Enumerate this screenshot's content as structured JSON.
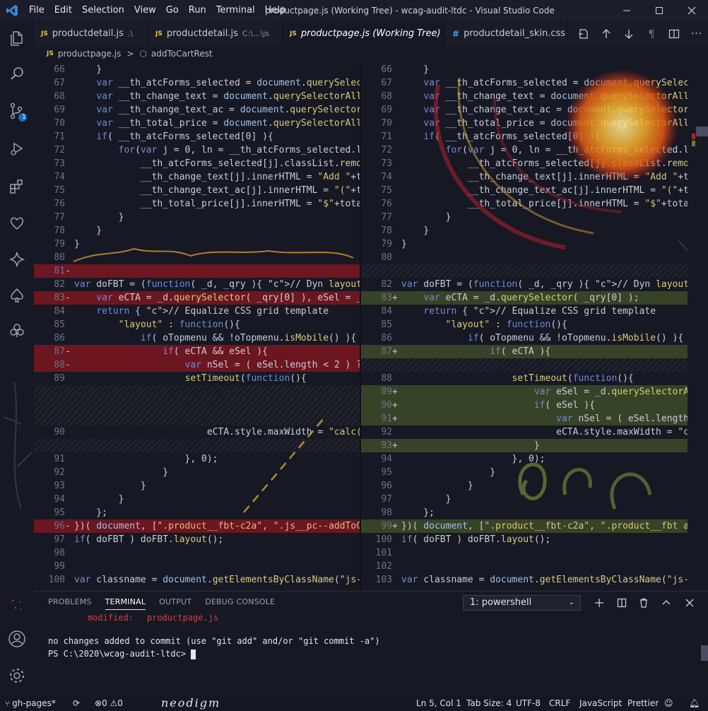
{
  "window": {
    "title": "productpage.js (Working Tree) - wcag-audit-ltdc - Visual Studio Code"
  },
  "menu": [
    "File",
    "Edit",
    "Selection",
    "View",
    "Go",
    "Run",
    "Terminal",
    "Help"
  ],
  "tabs": [
    {
      "icon": "JS",
      "label": "productdetail.js",
      "desc": ".\\"
    },
    {
      "icon": "JS",
      "label": "productdetail.js",
      "desc": "C:\\...\\js"
    },
    {
      "icon": "JS",
      "label": "productpage.js (Working Tree)",
      "desc": "",
      "active": true
    },
    {
      "icon": "#",
      "label": "productdetail_skin.css",
      "desc": ""
    }
  ],
  "breadcrumb": {
    "file": "productpage.js",
    "separator": ">",
    "symbol": "addToCartRest"
  },
  "scm_badge": "1",
  "colors": {
    "deleted": "#b4161e",
    "added": "#5f782d",
    "accent": "#0e70c0",
    "js_icon": "#e8c94a",
    "css_icon": "#4a9de0"
  },
  "left_lines": [
    {
      "n": "66",
      "m": "",
      "t": "    }",
      "cls": ""
    },
    {
      "n": "67",
      "m": "",
      "t": "    var __th_atcForms_selected = document.querySelectorAll(",
      "cls": ""
    },
    {
      "n": "68",
      "m": "",
      "t": "    var __th_change_text = document.querySelectorAll(",
      "cls": ""
    },
    {
      "n": "69",
      "m": "",
      "t": "    var __th_change_text_ac = document.querySelectorAll(",
      "cls": ""
    },
    {
      "n": "70",
      "m": "",
      "t": "    var __th_total_price = document.querySelectorAll(",
      "cls": ""
    },
    {
      "n": "71",
      "m": "",
      "t": "    if( __th_atcForms_selected[0] ){",
      "cls": ""
    },
    {
      "n": "72",
      "m": "",
      "t": "        for(var j = 0, ln = __th_atcForms_selected.length",
      "cls": ""
    },
    {
      "n": "73",
      "m": "",
      "t": "            __th_atcForms_selected[j].classList.remove(",
      "cls": ""
    },
    {
      "n": "74",
      "m": "",
      "t": "            __th_change_text[j].innerHTML = \"Add \"+total",
      "cls": ""
    },
    {
      "n": "75",
      "m": "",
      "t": "            __th_change_text_ac[j].innerHTML = \"(\"+tot",
      "cls": ""
    },
    {
      "n": "76",
      "m": "",
      "t": "            __th_total_price[j].innerHTML = \"$\"+total",
      "cls": ""
    },
    {
      "n": "77",
      "m": "",
      "t": "        }",
      "cls": ""
    },
    {
      "n": "78",
      "m": "",
      "t": "    }",
      "cls": ""
    },
    {
      "n": "79",
      "m": "",
      "t": "}",
      "cls": ""
    },
    {
      "n": "80",
      "m": "",
      "t": "",
      "cls": ""
    },
    {
      "n": "81",
      "m": "-",
      "t": "",
      "cls": "del"
    },
    {
      "n": "82",
      "m": "",
      "t": "var doFBT = (function( _d, _qry ){ // Dyn layout",
      "cls": ""
    },
    {
      "n": "83",
      "m": "-",
      "t": "    var eCTA = _d.querySelector( _qry[0] ), eSel = _d",
      "cls": "del"
    },
    {
      "n": "84",
      "m": "",
      "t": "    return { // Equalize CSS grid template",
      "cls": ""
    },
    {
      "n": "85",
      "m": "",
      "t": "        \"layout\" : function(){",
      "cls": ""
    },
    {
      "n": "86",
      "m": "",
      "t": "            if( oTopmenu && !oTopmenu.isMobile() ){",
      "cls": ""
    },
    {
      "n": "87",
      "m": "-",
      "t": "                if( eCTA && eSel ){",
      "cls": "del"
    },
    {
      "n": "88",
      "m": "-",
      "t": "                    var nSel = ( eSel.length < 2 ) ?",
      "cls": "del"
    },
    {
      "n": "89",
      "m": "",
      "t": "                    setTimeout(function(){",
      "cls": ""
    },
    {
      "n": "",
      "m": "",
      "t": "",
      "cls": "hatch"
    },
    {
      "n": "",
      "m": "",
      "t": "",
      "cls": "hatch"
    },
    {
      "n": "",
      "m": "",
      "t": "",
      "cls": "hatch"
    },
    {
      "n": "90",
      "m": "",
      "t": "                        eCTA.style.maxWidth = \"calc(1",
      "cls": ""
    },
    {
      "n": "",
      "m": "",
      "t": "",
      "cls": "hatch"
    },
    {
      "n": "91",
      "m": "",
      "t": "                    }, 0);",
      "cls": ""
    },
    {
      "n": "92",
      "m": "",
      "t": "                }",
      "cls": ""
    },
    {
      "n": "93",
      "m": "",
      "t": "            }",
      "cls": ""
    },
    {
      "n": "94",
      "m": "",
      "t": "        }",
      "cls": ""
    },
    {
      "n": "95",
      "m": "",
      "t": "    };",
      "cls": ""
    },
    {
      "n": "96",
      "m": "-",
      "t": "})( document, [\".product__fbt-c2a\", \".js__pc--addToCart",
      "cls": "del"
    },
    {
      "n": "97",
      "m": "",
      "t": "if( doFBT ) doFBT.layout();",
      "cls": ""
    },
    {
      "n": "98",
      "m": "",
      "t": "",
      "cls": ""
    },
    {
      "n": "99",
      "m": "",
      "t": "",
      "cls": ""
    },
    {
      "n": "100",
      "m": "",
      "t": "var classname = document.getElementsByClassName(\"js-p",
      "cls": ""
    }
  ],
  "right_lines": [
    {
      "n": "66",
      "m": "",
      "t": "    }",
      "cls": ""
    },
    {
      "n": "67",
      "m": "",
      "t": "    var __th_atcForms_selected = document.querySelectorAll(",
      "cls": ""
    },
    {
      "n": "68",
      "m": "",
      "t": "    var __th_change_text = document.querySelectorAll(",
      "cls": ""
    },
    {
      "n": "69",
      "m": "",
      "t": "    var __th_change_text_ac = document.querySelectorAll(",
      "cls": ""
    },
    {
      "n": "70",
      "m": "",
      "t": "    var __th_total_price = document.querySelectorAll(",
      "cls": ""
    },
    {
      "n": "71",
      "m": "",
      "t": "    if( __th_atcForms_selected[0] ){",
      "cls": ""
    },
    {
      "n": "72",
      "m": "",
      "t": "        for(var j = 0, ln = __th_atcForms_selected.length",
      "cls": ""
    },
    {
      "n": "73",
      "m": "",
      "t": "            __th_atcForms_selected[j].classList.remove(",
      "cls": ""
    },
    {
      "n": "74",
      "m": "",
      "t": "            __th_change_text[j].innerHTML = \"Add \"+tot",
      "cls": ""
    },
    {
      "n": "75",
      "m": "",
      "t": "            __th_change_text_ac[j].innerHTML = \"(\"+tot",
      "cls": ""
    },
    {
      "n": "76",
      "m": "",
      "t": "            __th_total_price[j].innerHTML = \"$\"+total",
      "cls": ""
    },
    {
      "n": "77",
      "m": "",
      "t": "        }",
      "cls": ""
    },
    {
      "n": "78",
      "m": "",
      "t": "    }",
      "cls": ""
    },
    {
      "n": "79",
      "m": "",
      "t": "}",
      "cls": ""
    },
    {
      "n": "80",
      "m": "",
      "t": "",
      "cls": ""
    },
    {
      "n": "",
      "m": "",
      "t": "",
      "cls": "hatch"
    },
    {
      "n": "82",
      "m": "",
      "t": "var doFBT = (function( _d, _qry ){ // Dyn layout",
      "cls": ""
    },
    {
      "n": "83",
      "m": "+",
      "t": "    var eCTA = _d.querySelector( _qry[0] );",
      "cls": "add"
    },
    {
      "n": "84",
      "m": "",
      "t": "    return { // Equalize CSS grid template",
      "cls": ""
    },
    {
      "n": "85",
      "m": "",
      "t": "        \"layout\" : function(){",
      "cls": ""
    },
    {
      "n": "86",
      "m": "",
      "t": "            if( oTopmenu && !oTopmenu.isMobile() ){",
      "cls": ""
    },
    {
      "n": "87",
      "m": "+",
      "t": "                if( eCTA ){",
      "cls": "add"
    },
    {
      "n": "",
      "m": "",
      "t": "",
      "cls": "hatch"
    },
    {
      "n": "88",
      "m": "",
      "t": "                    setTimeout(function(){",
      "cls": ""
    },
    {
      "n": "89",
      "m": "+",
      "t": "                        var eSel = _d.querySelectorAll",
      "cls": "add"
    },
    {
      "n": "90",
      "m": "+",
      "t": "                        if( eSel ){",
      "cls": "add"
    },
    {
      "n": "91",
      "m": "+",
      "t": "                            var nSel = ( eSel.length",
      "cls": "add"
    },
    {
      "n": "92",
      "m": "",
      "t": "                            eCTA.style.maxWidth = \"ca",
      "cls": ""
    },
    {
      "n": "93",
      "m": "+",
      "t": "                        }",
      "cls": "add"
    },
    {
      "n": "94",
      "m": "",
      "t": "                    }, 0);",
      "cls": ""
    },
    {
      "n": "95",
      "m": "",
      "t": "                }",
      "cls": ""
    },
    {
      "n": "96",
      "m": "",
      "t": "            }",
      "cls": ""
    },
    {
      "n": "97",
      "m": "",
      "t": "        }",
      "cls": ""
    },
    {
      "n": "98",
      "m": "",
      "t": "    };",
      "cls": ""
    },
    {
      "n": "99",
      "m": "+",
      "t": "})( document, [\".product__fbt-c2a\", \".product__fbt an",
      "cls": "add"
    },
    {
      "n": "100",
      "m": "",
      "t": "if( doFBT ) doFBT.layout();",
      "cls": ""
    },
    {
      "n": "101",
      "m": "",
      "t": "",
      "cls": ""
    },
    {
      "n": "102",
      "m": "",
      "t": "",
      "cls": ""
    },
    {
      "n": "103",
      "m": "",
      "t": "var classname = document.getElementsByClassName(\"js-p",
      "cls": ""
    }
  ],
  "panel": {
    "tabs": [
      "PROBLEMS",
      "TERMINAL",
      "OUTPUT",
      "DEBUG CONSOLE"
    ],
    "active_tab": "TERMINAL",
    "terminal_select": "1: powershell",
    "modified_label": "modified:",
    "modified_file": "productpage.js",
    "line2": "no changes added to commit (use \"git add\" and/or \"git commit -a\")",
    "prompt": "PS C:\\2020\\wcag-audit-ltdc> "
  },
  "status": {
    "branch": "gh-pages*",
    "errors": "0",
    "warnings": "0",
    "signature": "neodigm",
    "position": "Ln 5, Col 1",
    "tab_size": "Tab Size: 4",
    "encoding": "UTF-8",
    "eol": "CRLF",
    "language": "JavaScript",
    "formatter": "Prettier"
  }
}
